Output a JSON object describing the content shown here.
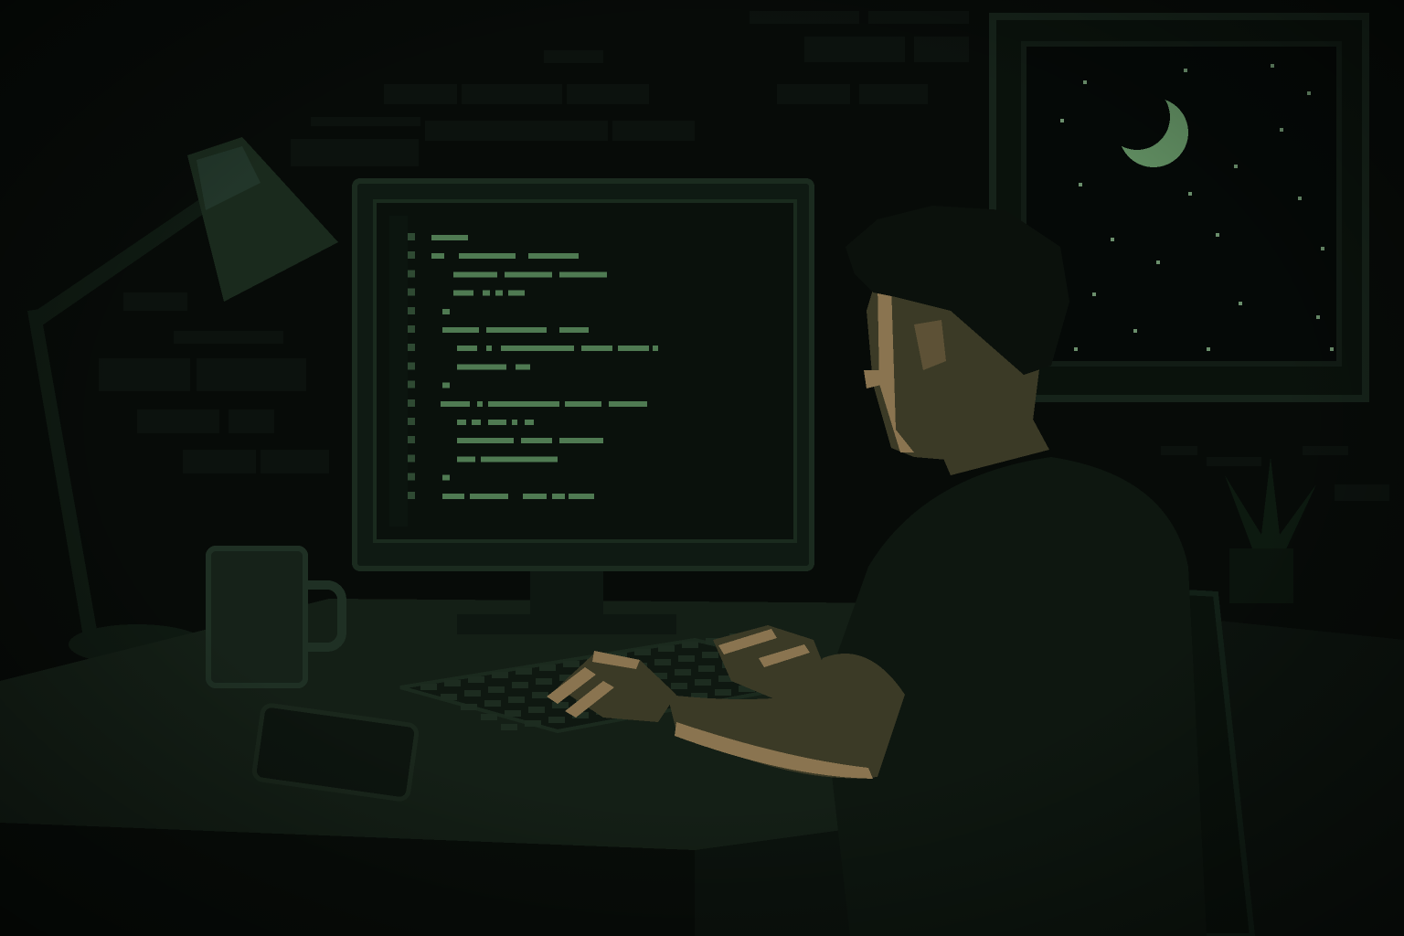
{
  "scene": {
    "subject": "person-typing-at-computer",
    "time_of_day": "night",
    "style": "pixel-art"
  },
  "palette": {
    "background": "#070b08",
    "wall_brick": "#0c120e",
    "monitor_frame": "#0f1a13",
    "screen_bg": "#0a110c",
    "code_green": "#4f7a52",
    "gutter_green": "#2f4a33",
    "skin": "#8a7450",
    "skin_shadow": "#3b3a26",
    "shirt": "#0e1710",
    "moon": "#5e8a5f",
    "star": "#6b8f6c",
    "desk": "#121b14",
    "lamp": "#1a2a1d"
  },
  "icons": {
    "moon": "crescent-moon-icon",
    "star": "star-icon"
  },
  "code_editor": {
    "visible_text": false
  }
}
